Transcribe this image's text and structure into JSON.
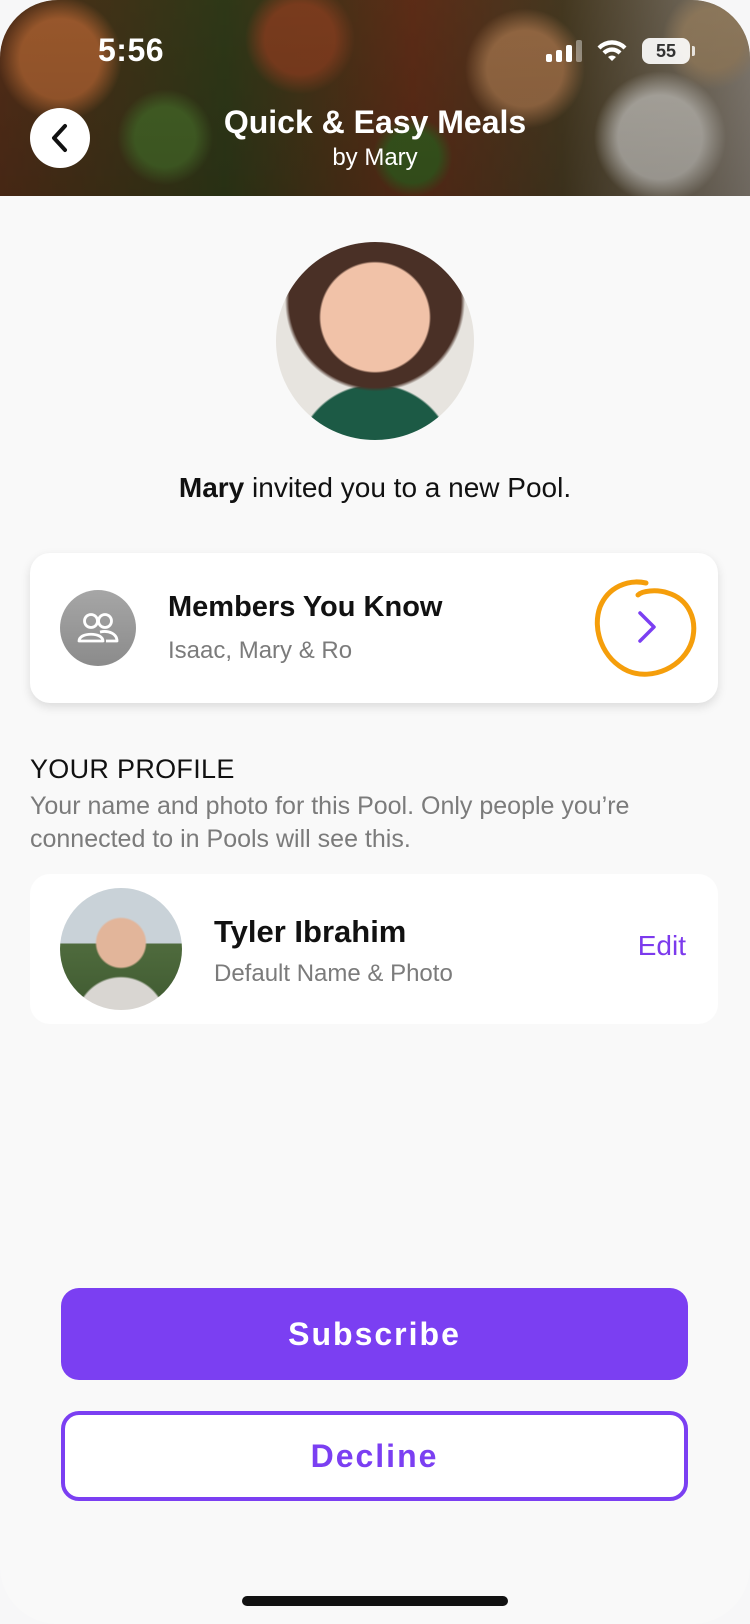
{
  "status_bar": {
    "time": "5:56",
    "battery": "55"
  },
  "header": {
    "title": "Quick & Easy Meals",
    "subtitle": "by Mary",
    "back_icon": "chevron-left-icon"
  },
  "invite": {
    "inviter_name": "Mary",
    "message": " invited you to a new Pool."
  },
  "members": {
    "title": "Members You Know",
    "names": "Isaac, Mary & Ro",
    "icon": "people-icon",
    "chevron_icon": "chevron-right-icon",
    "annotation_color": "#f59e0b"
  },
  "profile_section": {
    "title": "YOUR PROFILE",
    "description": "Your name and photo for this Pool. Only people you’re connected to in Pools will see this."
  },
  "profile": {
    "name": "Tyler Ibrahim",
    "subtitle": "Default Name & Photo",
    "edit_label": "Edit"
  },
  "actions": {
    "subscribe_label": "Subscribe",
    "decline_label": "Decline"
  },
  "colors": {
    "accent": "#7b3ff2",
    "muted_text": "#7b7b7b",
    "background": "#f9f9f9"
  }
}
